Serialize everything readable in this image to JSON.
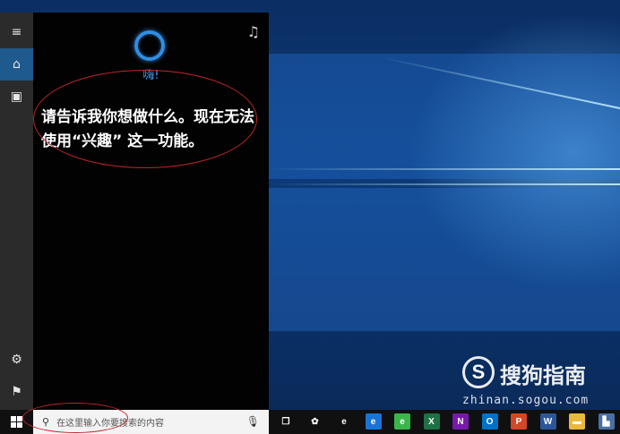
{
  "cortana": {
    "greeting": "嗨!",
    "message": "请告诉我你想做什么。现在无法使用“兴趣” 这一功能。",
    "rail": [
      {
        "icon": "hamburger-menu-icon",
        "glyph": "≡"
      },
      {
        "icon": "home-icon",
        "glyph": "⌂"
      },
      {
        "icon": "notebook-icon",
        "glyph": "▣"
      },
      {
        "icon": "gear-icon",
        "glyph": "⚙"
      },
      {
        "icon": "feedback-icon",
        "glyph": "⚑"
      }
    ],
    "music_glyph": "♫"
  },
  "taskbar": {
    "search_placeholder": "在这里输入你要搜索的内容",
    "search_glyph": "⚲",
    "mic_glyph": "🎙",
    "apps": [
      {
        "icon": "task-view-icon",
        "glyph": "❐",
        "bg": "#101010"
      },
      {
        "icon": "app-icon",
        "glyph": "✿",
        "bg": "#101010"
      },
      {
        "icon": "ie-icon",
        "glyph": "e",
        "bg": "#101010"
      },
      {
        "icon": "edge-icon",
        "glyph": "e",
        "bg": "#1a73d6"
      },
      {
        "icon": "browser-icon",
        "glyph": "e",
        "bg": "#3ab54a"
      },
      {
        "icon": "excel-icon",
        "glyph": "X",
        "bg": "#1e7145"
      },
      {
        "icon": "onenote-icon",
        "glyph": "N",
        "bg": "#7719aa"
      },
      {
        "icon": "outlook-icon",
        "glyph": "O",
        "bg": "#0072c6"
      },
      {
        "icon": "powerpoint-icon",
        "glyph": "P",
        "bg": "#d24726"
      },
      {
        "icon": "word-icon",
        "glyph": "W",
        "bg": "#2b579a"
      },
      {
        "icon": "file-explorer-icon",
        "glyph": "▬",
        "bg": "#e8b93c"
      },
      {
        "icon": "pc-icon",
        "glyph": "▙",
        "bg": "#4a6fa5"
      }
    ]
  },
  "watermark": {
    "logo_letter": "S",
    "title": "搜狗指南",
    "url": "zhinan.sogou.com"
  }
}
